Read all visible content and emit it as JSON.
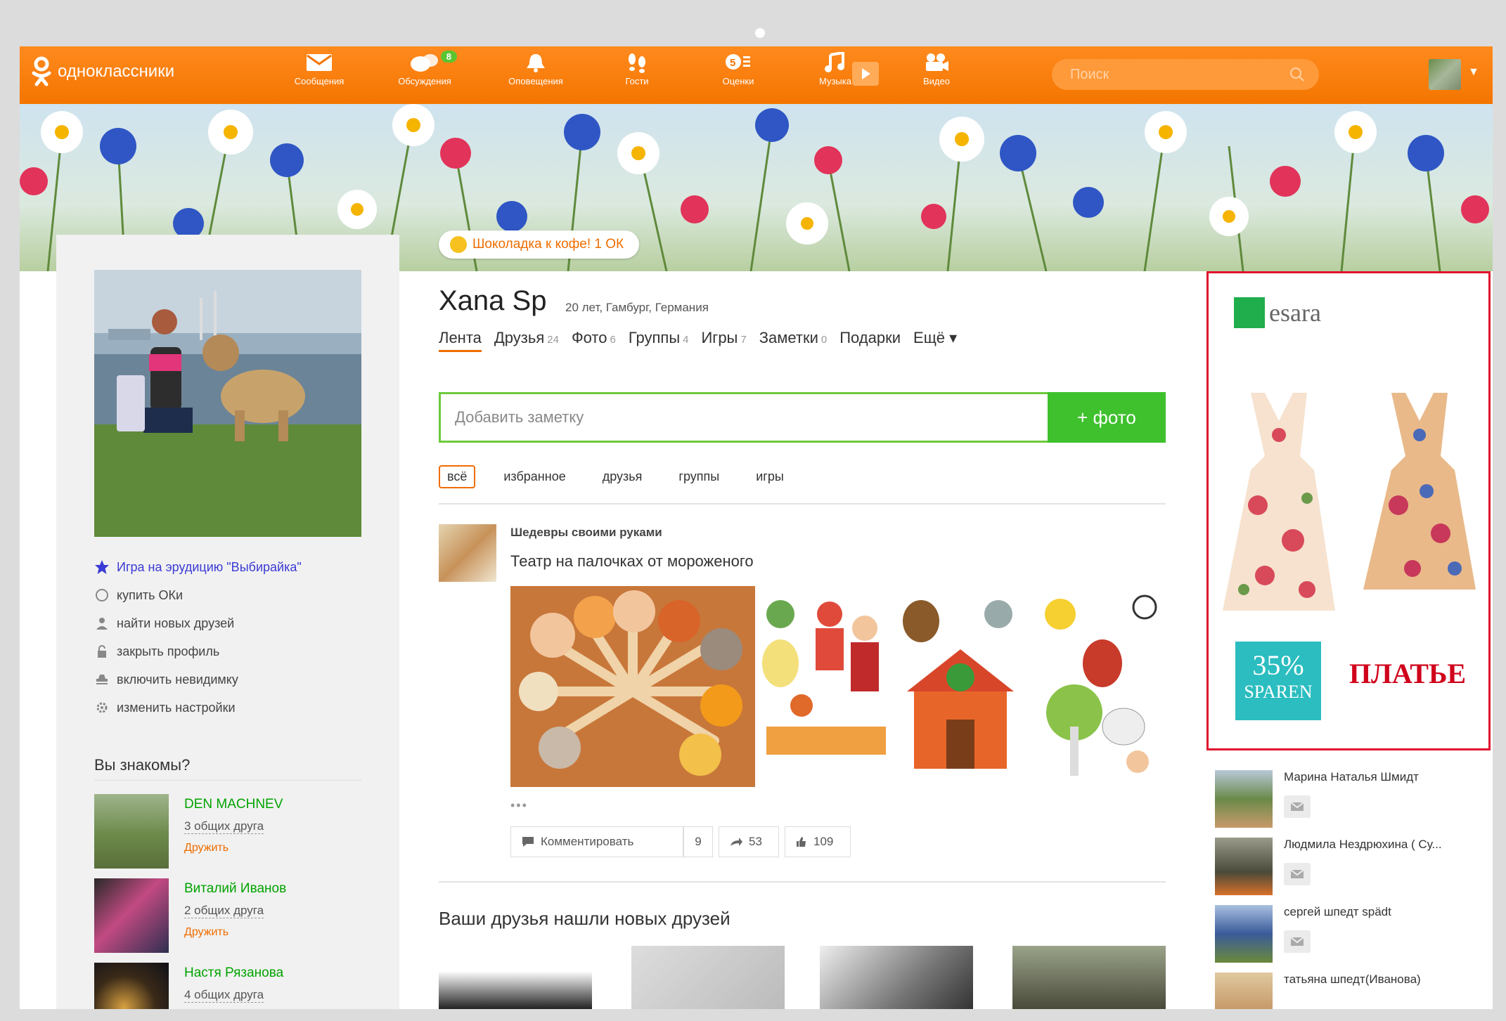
{
  "app": {
    "logo_text": "одноклассники"
  },
  "nav": [
    {
      "label": "Сообщения",
      "icon": "envelope-icon"
    },
    {
      "label": "Обсуждения",
      "icon": "chat-bubbles-icon",
      "badge": "8"
    },
    {
      "label": "Оповещения",
      "icon": "bell-icon"
    },
    {
      "label": "Гости",
      "icon": "footprints-icon"
    },
    {
      "label": "Оценки",
      "icon": "ratings-icon"
    },
    {
      "label": "Музыка",
      "icon": "music-note-icon"
    },
    {
      "label": "Видео",
      "icon": "video-camera-icon"
    }
  ],
  "search": {
    "placeholder": "Поиск"
  },
  "banner": {
    "status": "Шоколадка к кофе! 1 ОК"
  },
  "profile": {
    "name": "Xana Sp",
    "meta": "20 лет, Гамбург, Германия",
    "tabs": [
      {
        "label": "Лента",
        "count": ""
      },
      {
        "label": "Друзья",
        "count": "24"
      },
      {
        "label": "Фото",
        "count": "6"
      },
      {
        "label": "Группы",
        "count": "4"
      },
      {
        "label": "Игры",
        "count": "7"
      },
      {
        "label": "Заметки",
        "count": "0"
      },
      {
        "label": "Подарки",
        "count": ""
      },
      {
        "label": "Ещё ▾",
        "count": ""
      }
    ]
  },
  "left_links": [
    {
      "label": "Игра на эрудицию \"Выбирайка\"",
      "icon": "star-icon",
      "color": "#3a3ad6"
    },
    {
      "label": "купить ОКи",
      "icon": "coin-icon",
      "color": "#444444"
    },
    {
      "label": "найти новых друзей",
      "icon": "person-icon",
      "color": "#444444"
    },
    {
      "label": "закрыть профиль",
      "icon": "lock-icon",
      "color": "#444444"
    },
    {
      "label": "включить невидимку",
      "icon": "incognito-icon",
      "color": "#444444"
    },
    {
      "label": "изменить настройки",
      "icon": "gear-icon",
      "color": "#444444"
    }
  ],
  "known": {
    "title": "Вы знакомы?",
    "people": [
      {
        "name": "DEN MACHNEV",
        "common": "3 общих друга",
        "add": "Дружить"
      },
      {
        "name": "Виталий Иванов",
        "common": "2 общих друга",
        "add": "Дружить"
      },
      {
        "name": "Настя Рязанова",
        "common": "4 общих друга",
        "add": "Дружить"
      }
    ]
  },
  "composer": {
    "placeholder": "Добавить заметку",
    "photo_button": "+ фото"
  },
  "filters": [
    "всё",
    "избранное",
    "друзья",
    "группы",
    "игры"
  ],
  "post": {
    "group": "Шедевры своими руками",
    "title": "Театр на палочках от мороженого",
    "more": "•••",
    "actions": {
      "comment": "Комментировать",
      "comment_count": "9",
      "share_count": "53",
      "like_count": "109"
    }
  },
  "friends_section": {
    "title": "Ваши друзья нашли новых друзей"
  },
  "ad": {
    "brand": "esara",
    "percent": "35%",
    "sparen": "SPAREN",
    "word": "ПЛАТЬЕ"
  },
  "right_friends": [
    {
      "name": "Марина Наталья Шмидт"
    },
    {
      "name": "Людмила Нездрюхина ( Су..."
    },
    {
      "name": "сергей шпедт spädt"
    },
    {
      "name": "татьяна шпедт(Иванова)"
    }
  ],
  "colors": {
    "accent": "#ee6d00",
    "topbar": "#f47500",
    "green": "#3ec12d",
    "ad_border": "#e0132e"
  }
}
